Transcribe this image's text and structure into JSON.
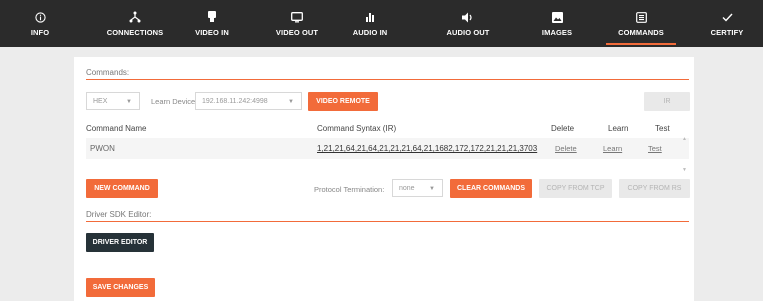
{
  "nav": {
    "tabs": [
      {
        "label": "INFO",
        "icon": "info-icon"
      },
      {
        "label": "CONNECTIONS",
        "icon": "connections-icon"
      },
      {
        "label": "VIDEO IN",
        "icon": "video-in-icon"
      },
      {
        "label": "VIDEO OUT",
        "icon": "video-out-icon"
      },
      {
        "label": "AUDIO IN",
        "icon": "audio-in-icon"
      },
      {
        "label": "AUDIO OUT",
        "icon": "audio-out-icon"
      },
      {
        "label": "IMAGES",
        "icon": "images-icon"
      },
      {
        "label": "COMMANDS",
        "icon": "commands-icon",
        "active": true
      },
      {
        "label": "CERTIFY",
        "icon": "check-icon"
      }
    ]
  },
  "commands": {
    "section_label": "Commands:",
    "format_select": "HEX",
    "learn_device_label": "Learn Device:",
    "learn_device_value": "192.168.11.242:4998",
    "video_remote_button": "VIDEO REMOTE",
    "ir_button": "IR",
    "columns": {
      "name": "Command Name",
      "syntax": "Command Syntax (IR)",
      "delete": "Delete",
      "learn": "Learn",
      "test": "Test"
    },
    "rows": [
      {
        "name": "PWON",
        "syntax": "1,21,21,64,21,64,21,21,21,64,21,1682,172,172,21,21,21,3703",
        "delete": "Delete",
        "learn": "Learn",
        "test": "Test"
      }
    ],
    "new_command_button": "NEW COMMAND",
    "protocol_termination_label": "Protocol Termination:",
    "protocol_termination_value": "none",
    "clear_commands_button": "CLEAR COMMANDS",
    "copy_from_tcp_button": "COPY FROM TCP",
    "copy_from_rs_button": "COPY FROM RS"
  },
  "driver": {
    "section_label": "Driver SDK Editor:",
    "driver_editor_button": "DRIVER EDITOR",
    "save_changes_button": "SAVE CHANGES"
  },
  "colors": {
    "accent": "#f26b3a",
    "nav_bg": "#2b2b2b",
    "dark_button": "#263238"
  }
}
